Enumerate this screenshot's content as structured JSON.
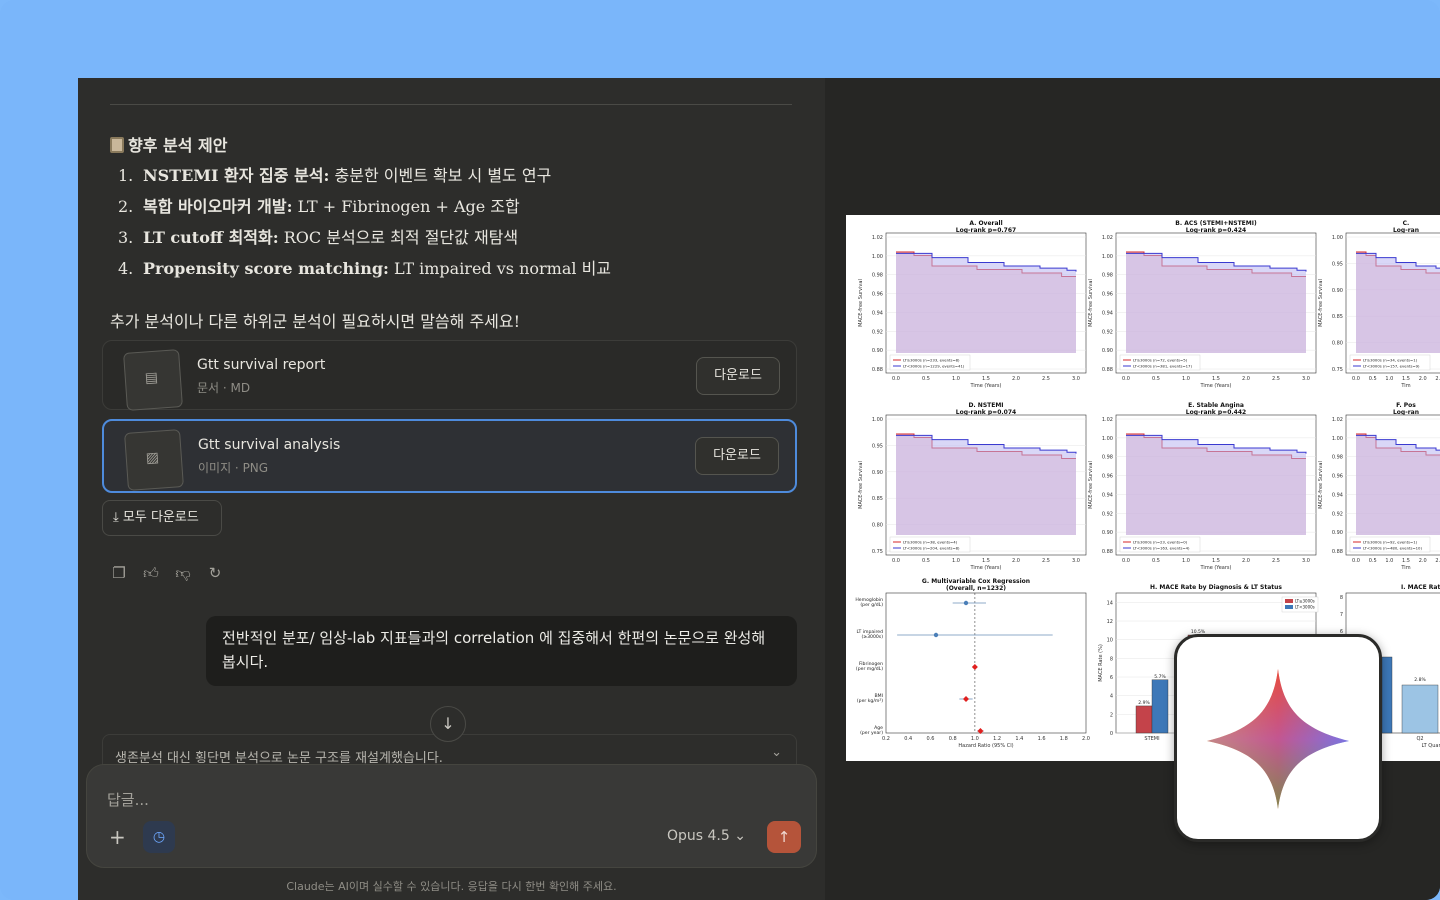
{
  "chat": {
    "section_title": "향후 분석 제안",
    "items": [
      {
        "num": "1.",
        "bold": "NSTEMI 환자 집중 분석:",
        "rest": " 충분한 이벤트 확보 시 별도 연구"
      },
      {
        "num": "2.",
        "bold": "복합 바이오마커 개발:",
        "rest": " LT + Fibrinogen + Age 조합"
      },
      {
        "num": "3.",
        "bold": "LT cutoff 최적화:",
        "rest": " ROC 분석으로 최적 절단값 재탐색"
      },
      {
        "num": "4.",
        "bold": "Propensity score matching:",
        "rest": " LT impaired vs normal 비교"
      }
    ],
    "followup": "추가 분석이나 다른 하위군 분석이 필요하시면 말씀해 주세요!",
    "files": [
      {
        "title": "Gtt survival report",
        "meta": "문서 · MD",
        "download": "다운로드"
      },
      {
        "title": "Gtt survival analysis",
        "meta": "이미지 · PNG",
        "download": "다운로드"
      }
    ],
    "download_all": "모두 다운로드",
    "user_message": "전반적인 분포/ 임상-lab 지표들과의 correlation 에 집중해서 한편의 논문으로 완성해 봅시다.",
    "collapsed_reply": "생존분석 대신 횡단면 분석으로 논문 구조를 재설계했습니다.",
    "composer_placeholder": "답글...",
    "model": "Opus 4.5",
    "disclaimer": "Claude는 AI이며 실수할 수 있습니다. 응답을 다시 한번 확인해 주세요."
  },
  "figure": {
    "panels": [
      {
        "title": "A. Overall",
        "subtitle": "Log-rank p=0.767",
        "ylabel": "MACE-free Survival",
        "xlabel": "Time (Years)",
        "ylim": [
          0.88,
          1.02
        ],
        "yticks": [
          "1.02",
          "1.00",
          "0.98",
          "0.96",
          "0.94",
          "0.92",
          "0.90",
          "0.88"
        ],
        "legend": [
          "LT≥3000s (n=233, events=8)",
          "LT<3000s (n=1229, events=41)"
        ]
      },
      {
        "title": "B. ACS (STEMI+NSTEMI)",
        "subtitle": "Log-rank p=0.424",
        "ylabel": "MACE-free Survival",
        "xlabel": "Time (Years)",
        "ylim": [
          0.88,
          1.02
        ],
        "yticks": [
          "1.02",
          "1.00",
          "0.98",
          "0.96",
          "0.94",
          "0.92",
          "0.90",
          "0.88"
        ],
        "legend": [
          "LT≥3000s (n=72, events=5)",
          "LT<3000s (n=381, events=17)"
        ]
      },
      {
        "title": "C.",
        "subtitle": "Log-ran",
        "ylabel": "MACE-free Survival",
        "xlabel": "Tim",
        "ylim": [
          0.75,
          1.0
        ],
        "yticks": [
          "1.00",
          "0.95",
          "0.90",
          "0.85",
          "0.80",
          "0.75"
        ],
        "legend": [
          "LT≥3000s (n=34, events=1)",
          "LT<3000s (n=157, events=9)"
        ]
      },
      {
        "title": "D. NSTEMI",
        "subtitle": "Log-rank p=0.074",
        "ylabel": "MACE-free Survival",
        "xlabel": "Time (Years)",
        "ylim": [
          0.75,
          1.0
        ],
        "yticks": [
          "1.00",
          "0.95",
          "0.90",
          "0.85",
          "0.80",
          "0.75"
        ],
        "legend": [
          "LT≥3000s (n=38, events=4)",
          "LT<3000s (n=204, events=8)"
        ]
      },
      {
        "title": "E. Stable Angina",
        "subtitle": "Log-rank p=0.442",
        "ylabel": "MACE-free Survival",
        "xlabel": "Time (Years)",
        "ylim": [
          0.88,
          1.02
        ],
        "yticks": [
          "1.02",
          "1.00",
          "0.98",
          "0.96",
          "0.94",
          "0.92",
          "0.90",
          "0.88"
        ],
        "legend": [
          "LT≥3000s (n=23, events=0)",
          "LT<3000s (n=163, events=4)"
        ]
      },
      {
        "title": "F. Pos",
        "subtitle": "Log-ran",
        "ylabel": "MACE-free Survival",
        "xlabel": "Tim",
        "ylim": [
          0.88,
          1.02
        ],
        "yticks": [
          "1.02",
          "1.00",
          "0.98",
          "0.96",
          "0.94",
          "0.92",
          "0.90",
          "0.88"
        ],
        "legend": [
          "LT≥3000s (n=92, events=1)",
          "LT<3000s (n=480, events=10)"
        ]
      }
    ],
    "xticks": [
      "0.0",
      "0.5",
      "1.0",
      "1.5",
      "2.0",
      "2.5",
      "3.0"
    ],
    "colors": {
      "high": "#d62728",
      "low": "#3a3ad0",
      "high_fill": "#f7b6b8",
      "low_fill": "#b9b6f0",
      "bar_red": "#c4434a",
      "bar_blue": "#3d78b8",
      "bar_light": "#9cc4e4",
      "marker_blue": "#4b7fb8",
      "marker_red": "#e0201f"
    },
    "forest": {
      "title": "G. Multivariable Cox Regression",
      "subtitle": "(Overall, n=1232)",
      "xlabel": "Hazard Ratio (95% CI)",
      "xticks": [
        "0.2",
        "0.4",
        "0.6",
        "0.8",
        "1.0",
        "1.2",
        "1.4",
        "1.6",
        "1.8",
        "2.0"
      ],
      "rows": [
        {
          "label": "Hemoglobin",
          "label2": "(per g/dL)",
          "hr": 0.92,
          "lo": 0.8,
          "hi": 1.1,
          "color": "marker_blue"
        },
        {
          "label": "LT impaired",
          "label2": "(≥3000s)",
          "hr": 0.65,
          "lo": 0.3,
          "hi": 1.7,
          "color": "marker_blue"
        },
        {
          "label": "Fibrinogen",
          "label2": "(per mg/dL)",
          "hr": 1.0,
          "lo": 0.99,
          "hi": 1.01,
          "color": "marker_red"
        },
        {
          "label": "BMI",
          "label2": "(per kg/m²)",
          "hr": 0.92,
          "lo": 0.86,
          "hi": 0.98,
          "color": "marker_red"
        },
        {
          "label": "Age",
          "label2": "(per year)",
          "hr": 1.05,
          "lo": 1.02,
          "hi": 1.08,
          "color": "marker_red"
        }
      ]
    },
    "barH": {
      "title": "H. MACE Rate by Diagnosis & LT Status",
      "ylabel": "MACE Rate (%)",
      "yticks": [
        "14",
        "12",
        "10",
        "8",
        "6",
        "4",
        "2",
        "0"
      ],
      "ylim": [
        0,
        15
      ],
      "legend": [
        "LT≥3000s",
        "LT<3000s"
      ],
      "categories": [
        "STEMI"
      ],
      "values_high": [
        2.9
      ],
      "values_low": [
        5.7
      ],
      "extra_label": "10.5%"
    },
    "barI": {
      "title": "I. MACE Rat",
      "yticks": [
        "8",
        "7",
        "6"
      ],
      "categories": [
        "Q2"
      ],
      "xlabel": "LT Quart",
      "value_label": "2.8%"
    }
  }
}
